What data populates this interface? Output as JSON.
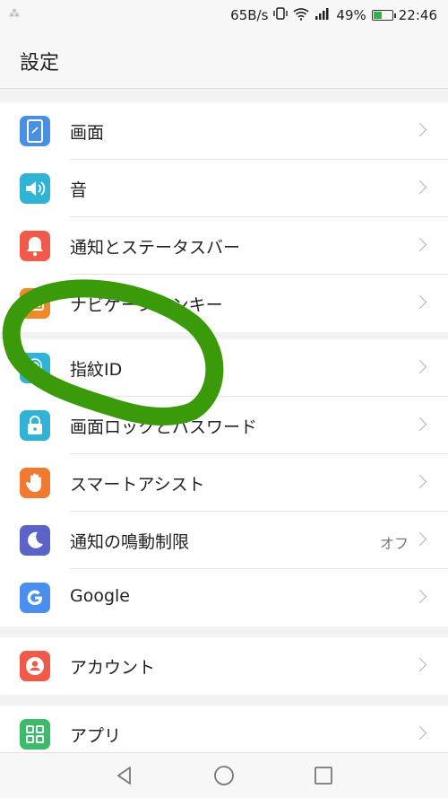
{
  "statusbar": {
    "net_speed": "65B/s",
    "battery_percent": "49%",
    "battery_level": 0.49,
    "time": "22:46",
    "icons": [
      "notification-icon",
      "vibrate-icon",
      "wifi-icon",
      "signal-icon",
      "battery-icon"
    ]
  },
  "header": {
    "title": "設定"
  },
  "groups": [
    {
      "items": [
        {
          "label": "画面",
          "icon": "display-icon",
          "color": "#4a90e2"
        },
        {
          "label": "音",
          "icon": "speaker-icon",
          "color": "#30b3d5"
        },
        {
          "label": "通知とステータスバー",
          "icon": "bell-icon",
          "color": "#f05a4a"
        },
        {
          "label": "ナビゲーションキー",
          "icon": "navigation-key-icon",
          "color": "#f08a24"
        }
      ]
    },
    {
      "items": [
        {
          "label": "指紋ID",
          "icon": "fingerprint-icon",
          "color": "#30b3d5"
        },
        {
          "label": "画面ロックとパスワード",
          "icon": "lock-icon",
          "color": "#30b3d5"
        },
        {
          "label": "スマートアシスト",
          "icon": "hand-icon",
          "color": "#f07a30"
        },
        {
          "label": "通知の鳴動制限",
          "icon": "moon-icon",
          "color": "#5b63c9",
          "value": "オフ"
        },
        {
          "label": "Google",
          "icon": "google-icon",
          "color": "#4a8ff0"
        }
      ]
    },
    {
      "items": [
        {
          "label": "アカウント",
          "icon": "account-icon",
          "color": "#f05a4a"
        }
      ]
    },
    {
      "items": [
        {
          "label": "アプリ",
          "icon": "apps-icon",
          "color": "#3dbb6a"
        }
      ]
    }
  ],
  "annotation": {
    "shape": "hand-drawn-circle",
    "color": "#3a9a0a"
  },
  "navbar": {
    "icons": [
      "back-icon",
      "home-icon",
      "recents-icon"
    ]
  }
}
